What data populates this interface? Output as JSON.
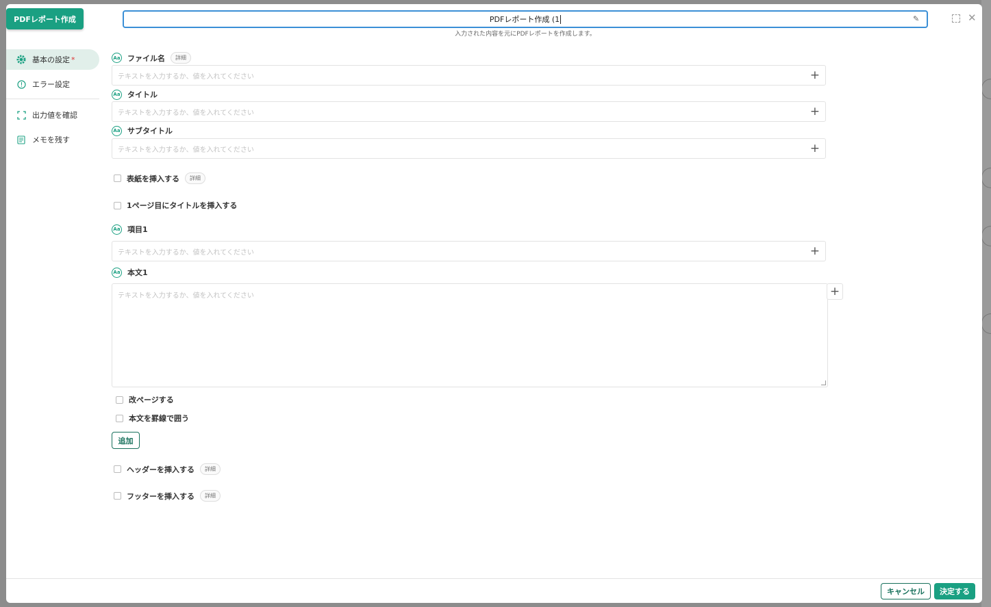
{
  "node_badge": "PDFレポート作成",
  "header": {
    "title_value": "PDFレポート作成 (1",
    "description": "入力された内容を元にPDFレポートを作成します。"
  },
  "sidebar": {
    "items": [
      {
        "label": "基本の設定",
        "required_mark": "*",
        "icon": "gear-icon",
        "active": true
      },
      {
        "label": "エラー設定",
        "icon": "alert-circle-icon",
        "active": false
      },
      {
        "label": "出力値を確認",
        "icon": "output-frame-icon",
        "active": false
      },
      {
        "label": "メモを残す",
        "icon": "memo-icon",
        "active": false
      }
    ]
  },
  "form": {
    "text_type_icon": "Aa",
    "placeholder": "テキストを入力するか、値を入れてください",
    "detail_chip": "詳細",
    "file_name_label": "ファイル名",
    "title_label": "タイトル",
    "subtitle_label": "サブタイトル",
    "insert_cover_label": "表紙を挿入する",
    "insert_title_first_page_label": "1ページ目にタイトルを挿入する",
    "item1_label": "項目1",
    "body1_label": "本文1",
    "page_break_label": "改ページする",
    "body_border_label": "本文を罫線で囲う",
    "add_button": "追加",
    "insert_header_label": "ヘッダーを挿入する",
    "insert_footer_label": "フッターを挿入する"
  },
  "footer": {
    "cancel": "キャンセル",
    "confirm": "決定する"
  },
  "colors": {
    "accent": "#1aa082",
    "accent_dark": "#16705b",
    "focus_border": "#3a8fd6"
  }
}
